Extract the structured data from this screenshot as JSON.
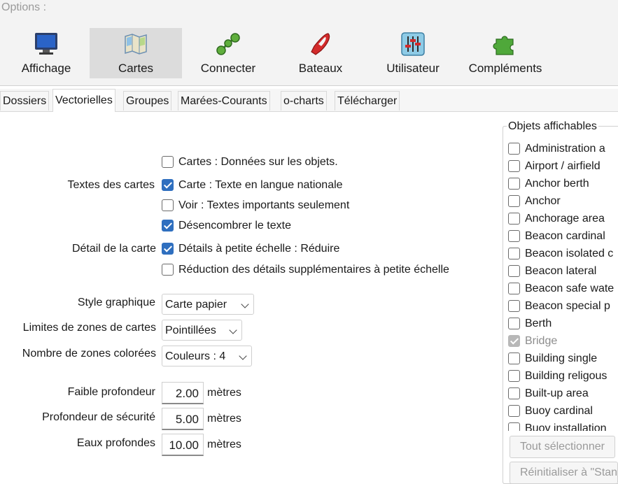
{
  "window": {
    "title": "Options :"
  },
  "toolbar": {
    "items": [
      {
        "label": "Affichage",
        "icon": "monitor-icon"
      },
      {
        "label": "Cartes",
        "icon": "charts-icon",
        "selected": true
      },
      {
        "label": "Connecter",
        "icon": "connect-icon"
      },
      {
        "label": "Bateaux",
        "icon": "boat-icon"
      },
      {
        "label": "Utilisateur",
        "icon": "sliders-icon"
      },
      {
        "label": "Compléments",
        "icon": "puzzle-icon"
      }
    ]
  },
  "tabs": [
    {
      "label": "Dossiers"
    },
    {
      "label": "Vectorielles",
      "active": true
    },
    {
      "label": "Groupes"
    },
    {
      "label": "Marées-Courants"
    },
    {
      "label": "o-charts"
    },
    {
      "label": "Télécharger"
    }
  ],
  "chart_texts": {
    "label": "Textes des cartes",
    "options": [
      {
        "label": "Cartes : Données sur les objets.",
        "checked": false
      },
      {
        "label": "Carte : Texte en langue nationale",
        "checked": true
      },
      {
        "label": "Voir : Textes importants seulement",
        "checked": false
      },
      {
        "label": "Désencombrer le texte",
        "checked": true
      }
    ]
  },
  "chart_detail": {
    "label": "Détail de la carte",
    "options": [
      {
        "label": "Détails à petite échelle : Réduire",
        "checked": true
      },
      {
        "label": "Réduction des détails supplémentaires à petite échelle",
        "checked": false
      }
    ]
  },
  "selects": {
    "style": {
      "label": "Style graphique",
      "value": "Carte papier"
    },
    "boundaries": {
      "label": "Limites de zones de cartes",
      "value": "Pointillées"
    },
    "colors": {
      "label": "Nombre de zones colorées",
      "value": "Couleurs : 4"
    }
  },
  "depths": {
    "shallow": {
      "label": "Faible profondeur",
      "value": "2.00",
      "unit": "mètres"
    },
    "safety": {
      "label": "Profondeur de sécurité",
      "value": "5.00",
      "unit": "mètres"
    },
    "deep": {
      "label": "Eaux profondes",
      "value": "10.00",
      "unit": "mètres"
    }
  },
  "objects": {
    "title": "Objets affichables",
    "items": [
      {
        "label": "Administration a",
        "checked": false
      },
      {
        "label": "Airport / airfield",
        "checked": false
      },
      {
        "label": "Anchor berth",
        "checked": false
      },
      {
        "label": "Anchor",
        "checked": false
      },
      {
        "label": "Anchorage area",
        "checked": false
      },
      {
        "label": "Beacon cardinal",
        "checked": false
      },
      {
        "label": "Beacon isolated c",
        "checked": false
      },
      {
        "label": "Beacon lateral",
        "checked": false
      },
      {
        "label": "Beacon safe wate",
        "checked": false
      },
      {
        "label": "Beacon special p",
        "checked": false
      },
      {
        "label": "Berth",
        "checked": false
      },
      {
        "label": "Bridge",
        "checked": true,
        "disabled": true
      },
      {
        "label": "Building single",
        "checked": false
      },
      {
        "label": "Building religous",
        "checked": false
      },
      {
        "label": "Built-up area",
        "checked": false
      },
      {
        "label": "Buoy cardinal",
        "checked": false
      },
      {
        "label": "Buoy installation",
        "checked": false
      }
    ],
    "select_all": "Tout sélectionner",
    "reset": "Réinitialiser à \"Stan"
  }
}
